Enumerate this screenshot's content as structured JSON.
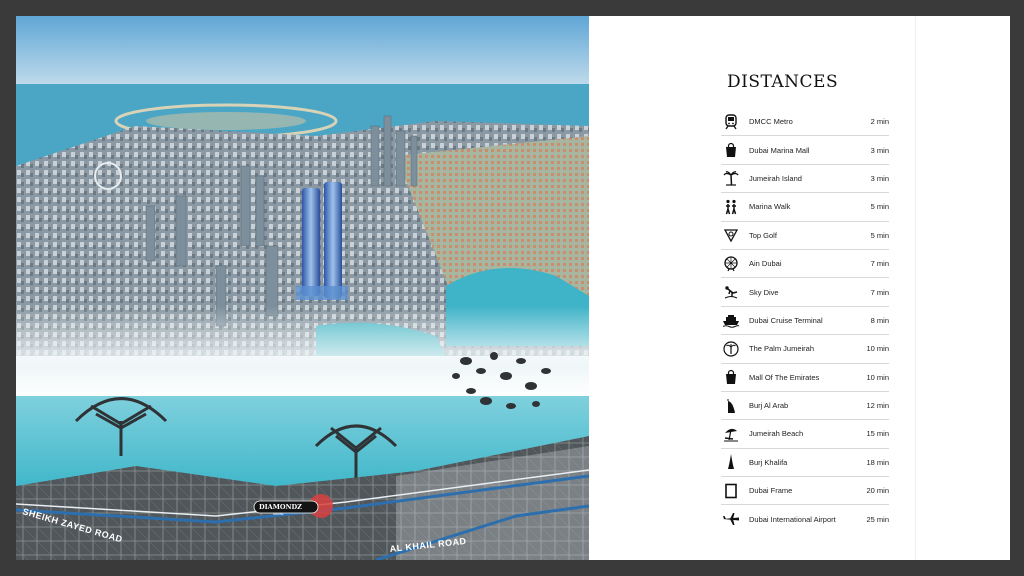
{
  "map": {
    "road_1": "SHEIKH ZAYED ROAD",
    "road_2": "AL KHAIL ROAD",
    "brand": "DIAMONDZ",
    "brand_sub": "DANUBE"
  },
  "distances": {
    "title": "DISTANCES",
    "items": [
      {
        "label": "DMCC Metro",
        "time": "2 min",
        "icon": "metro-icon"
      },
      {
        "label": "Dubai Marina Mall",
        "time": "3 min",
        "icon": "shopping-bag-icon"
      },
      {
        "label": "Jumeirah Island",
        "time": "3 min",
        "icon": "palm-tree-icon"
      },
      {
        "label": "Marina Walk",
        "time": "5 min",
        "icon": "walking-people-icon"
      },
      {
        "label": "Top Golf",
        "time": "5 min",
        "icon": "golf-icon"
      },
      {
        "label": "Ain Dubai",
        "time": "7 min",
        "icon": "ferris-wheel-icon"
      },
      {
        "label": "Sky Dive",
        "time": "7 min",
        "icon": "skydiver-icon"
      },
      {
        "label": "Dubai Cruise Terminal",
        "time": "8 min",
        "icon": "cruise-ship-icon"
      },
      {
        "label": "The Palm Jumeirah",
        "time": "10 min",
        "icon": "palm-circle-icon"
      },
      {
        "label": "Mall Of The Emirates",
        "time": "10 min",
        "icon": "shopping-bag-icon"
      },
      {
        "label": "Burj Al Arab",
        "time": "12 min",
        "icon": "burj-al-arab-icon"
      },
      {
        "label": "Jumeirah Beach",
        "time": "15 min",
        "icon": "beach-icon"
      },
      {
        "label": "Burj Khalifa",
        "time": "18 min",
        "icon": "burj-khalifa-icon"
      },
      {
        "label": "Dubai Frame",
        "time": "20 min",
        "icon": "frame-icon"
      },
      {
        "label": "Dubai International Airport",
        "time": "25 min",
        "icon": "airplane-icon"
      }
    ]
  }
}
